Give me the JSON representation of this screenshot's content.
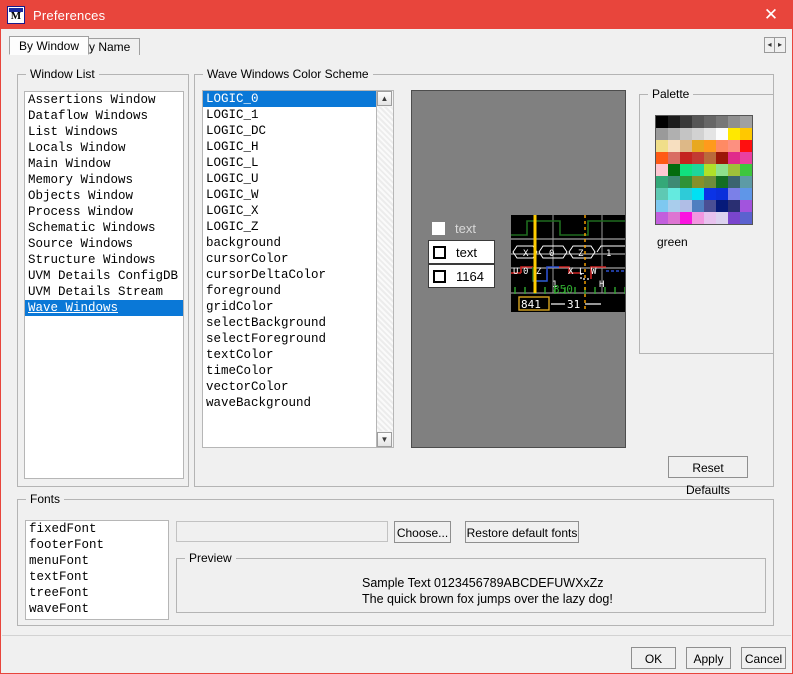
{
  "window": {
    "title": "Preferences",
    "icon": "modelsim-m-icon",
    "close_label": "✕",
    "accent_color": "#e8453c"
  },
  "tabs": [
    {
      "id": "by-window",
      "label": "By Window",
      "active": true
    },
    {
      "id": "by-name",
      "label": "By Name",
      "active": false
    }
  ],
  "tab_nav": {
    "left_label": "◂",
    "right_label": "▸"
  },
  "window_list": {
    "legend": "Window List",
    "items": [
      "Assertions Window",
      "Dataflow Windows",
      "List Windows",
      "Locals Window",
      "Main Window",
      "Memory Windows",
      "Objects Window",
      "Process Window",
      "Schematic Windows",
      "Source Windows",
      "Structure Windows",
      "UVM Details ConfigDB",
      "UVM Details Stream",
      "Wave Windows"
    ],
    "selected_index": 13
  },
  "color_scheme": {
    "legend": "Wave Windows Color Scheme",
    "items": [
      "LOGIC_0",
      "LOGIC_1",
      "LOGIC_DC",
      "LOGIC_H",
      "LOGIC_L",
      "LOGIC_U",
      "LOGIC_W",
      "LOGIC_X",
      "LOGIC_Z",
      "background",
      "cursorColor",
      "cursorDeltaColor",
      "foreground",
      "gridColor",
      "selectBackground",
      "selectForeground",
      "textColor",
      "timeColor",
      "vectorColor",
      "waveBackground"
    ],
    "selected_index": 0,
    "scrollbar": {
      "up_label": "▲",
      "down_label": "▼"
    }
  },
  "preview": {
    "rows": [
      {
        "label": "text",
        "selected": false
      },
      {
        "label": "text",
        "selected": true
      },
      {
        "label": "1164",
        "selected": true
      }
    ],
    "wave": {
      "vector_values": [
        "X",
        "0",
        "Z",
        "1"
      ],
      "logic_values": [
        "U",
        "0",
        "Z",
        "X",
        "L",
        "W",
        "H",
        "1",
        "-"
      ],
      "cursor_time": "850",
      "cursor_box_value": "841",
      "delta_value": "31",
      "cursor_color": "#ffcc00",
      "delta_cursor_color": "#ffa500",
      "background": "#000000",
      "grid_color": "#c8c8c8"
    }
  },
  "palette": {
    "legend": "Palette",
    "selected_name": "green",
    "columns": 8,
    "colors": [
      "#000000",
      "#1c1c1c",
      "#393939",
      "#555555",
      "#666666",
      "#777777",
      "#8f8f8f",
      "#a0a0a0",
      "#9a9a9a",
      "#b0b0b0",
      "#c4c4c4",
      "#d2d2d2",
      "#e4e4e4",
      "#fcfcfc",
      "#ffe800",
      "#ffc800",
      "#f0de89",
      "#f7dfc0",
      "#ddb887",
      "#e8a81f",
      "#ff9a1c",
      "#ff8a64",
      "#fd9080",
      "#ff0f0f",
      "#ff5a14",
      "#d96d63",
      "#c4241f",
      "#c23a33",
      "#ba6a3b",
      "#9c1708",
      "#e02a8b",
      "#ea3fa0",
      "#ffc8d2",
      "#046b0e",
      "#11e07e",
      "#1ed69a",
      "#b0e029",
      "#8fe08c",
      "#9fc03a",
      "#3ec63e",
      "#34a878",
      "#3e8a74",
      "#2f9238",
      "#86902a",
      "#6f8c3c",
      "#136e23",
      "#3b6470",
      "#5d9ba6",
      "#5ec9b3",
      "#64eadf",
      "#2ecbd8",
      "#00e1f4",
      "#0b33e6",
      "#0b2fdb",
      "#7b80e8",
      "#5f96e8",
      "#7ec8f0",
      "#a9cdec",
      "#b0bee6",
      "#4f7fc0",
      "#4a4f94",
      "#061a7a",
      "#2a2f72",
      "#a254dd",
      "#c25fdd",
      "#dd74d2",
      "#fb14e0",
      "#f396e0",
      "#e8c2ee",
      "#dcd2ef",
      "#7a45cd",
      "#5b62cf"
    ]
  },
  "reset_defaults": {
    "label": "Reset Defaults"
  },
  "fonts": {
    "legend": "Fonts",
    "items": [
      "fixedFont",
      "footerFont",
      "menuFont",
      "textFont",
      "treeFont",
      "waveFont"
    ],
    "field_value": "",
    "field_placeholder": "",
    "choose_label": "Choose...",
    "restore_label": "Restore default fonts",
    "preview": {
      "legend": "Preview",
      "line1": "Sample Text 0123456789ABCDEFUWXxZz",
      "line2": "The quick brown fox jumps over the lazy dog!"
    }
  },
  "footer": {
    "ok": "OK",
    "apply": "Apply",
    "cancel": "Cancel"
  }
}
